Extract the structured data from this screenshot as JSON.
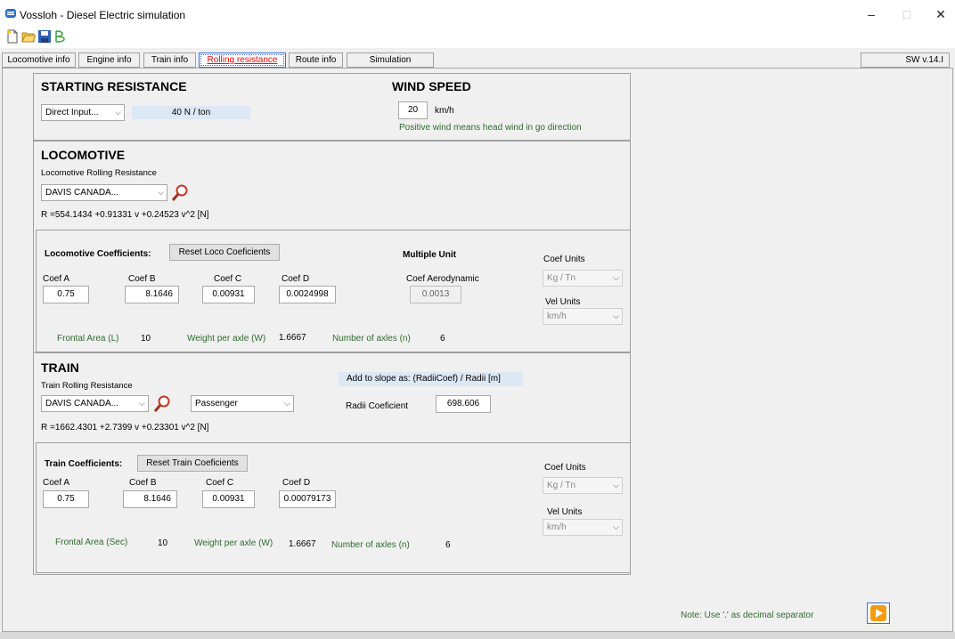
{
  "window": {
    "title": "Vossloh - Diesel Electric simulation",
    "minimize": "–",
    "maximize": "□",
    "close": "✕"
  },
  "toolbar": {
    "icons": [
      "new-file-icon",
      "open-folder-icon",
      "save-disk-icon",
      "script-icon"
    ]
  },
  "tabs": [
    "Locomotive info",
    "Engine info",
    "Train info",
    "Rolling resistance",
    "Route info",
    "Simulation"
  ],
  "active_tab": "Rolling resistance",
  "version": "SW v.14.I",
  "starting_resistance": {
    "title": "STARTING RESISTANCE",
    "mode": "Direct Input...",
    "value": "40 N / ton"
  },
  "wind_speed": {
    "title": "WIND SPEED",
    "value": "20",
    "unit": "km/h",
    "note": "Positive wind means head wind in go direction"
  },
  "locomotive": {
    "title": "LOCOMOTIVE",
    "subtitle": "Locomotive Rolling Resistance",
    "model": "DAVIS CANADA...",
    "formula": "R =554.1434 +0.91331 v +0.24523 v^2  [N]",
    "coefficients_label": "Locomotive Coefficients:",
    "reset_button": "Reset Loco Coeficients",
    "multiple_unit": "Multiple Unit",
    "coef_a_label": "Coef A",
    "coef_a": "0.75",
    "coef_b_label": "Coef B",
    "coef_b": "8.1646",
    "coef_c_label": "Coef C",
    "coef_c": "0.00931",
    "coef_d_label": "Coef D",
    "coef_d": "0.0024998",
    "coef_aero_label": "Coef Aerodynamic",
    "coef_aero": "0.0013",
    "coef_units_label": "Coef Units",
    "coef_units": "Kg / Tn",
    "vel_units_label": "Vel Units",
    "vel_units": "km/h",
    "frontal_area_label": "Frontal Area (L)",
    "frontal_area": "10",
    "weight_label": "Weight per axle (W)",
    "weight": "1.6667",
    "axles_label": "Number of axles (n)",
    "axles": "6"
  },
  "train": {
    "title": "TRAIN",
    "subtitle": "Train Rolling Resistance",
    "model": "DAVIS CANADA...",
    "type": "Passenger",
    "slope_note": "Add to slope as: (RadiiCoef) / Radii [m]",
    "radii_label": "Radii Coeficient",
    "radii": "698.606",
    "formula": "R =1662.4301 +2.7399 v +0.23301 v^2  [N]",
    "coefficients_label": "Train Coefficients:",
    "reset_button": "Reset Train Coeficients",
    "coef_a_label": "Coef A",
    "coef_a": "0.75",
    "coef_b_label": "Coef B",
    "coef_b": "8.1646",
    "coef_c_label": "Coef C",
    "coef_c": "0.00931",
    "coef_d_label": "Coef D",
    "coef_d": "0.00079173",
    "coef_units_label": "Coef Units",
    "coef_units": "Kg / Tn",
    "vel_units_label": "Vel Units",
    "vel_units": "km/h",
    "frontal_area_label": "Frontal Area (Sec)",
    "frontal_area": "10",
    "weight_label": "Weight per axle (W)",
    "weight": "1.6667",
    "axles_label": "Number of axles (n)",
    "axles": "6"
  },
  "footer": {
    "note": "Note: Use '.' as decimal separator"
  },
  "colors": {
    "accent": "#3a6fd8",
    "label_green": "#2e6b2e",
    "active_tab_text": "#ff0000",
    "value_box": "#dde8f5"
  }
}
